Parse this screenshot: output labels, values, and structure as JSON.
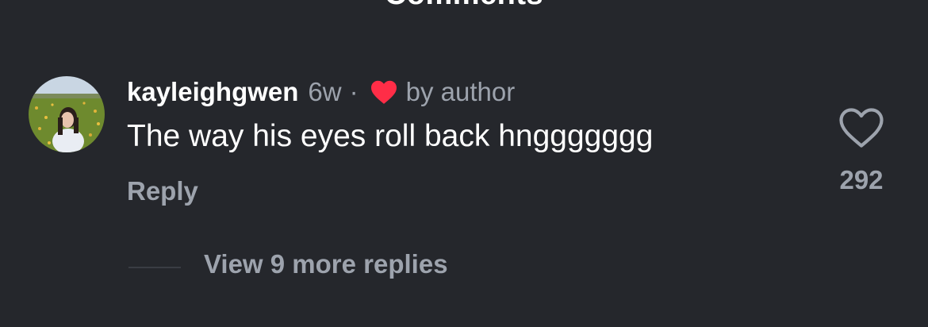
{
  "sheet": {
    "title": "Comments"
  },
  "comment": {
    "username": "kayleighgwen",
    "timestamp": "6w",
    "separator": "·",
    "author_badge": {
      "icon": "heart-icon",
      "color": "#ff2d47",
      "label": "by author"
    },
    "text": "The way his eyes roll back hnggggggg",
    "reply_label": "Reply",
    "like": {
      "icon": "heart-outline-icon",
      "count": "292"
    },
    "view_replies_label": "View 9 more replies"
  },
  "colors": {
    "background": "#25272c",
    "primary_text": "#ffffff",
    "secondary_text": "#9da3ad",
    "author_heart": "#ff2d47"
  }
}
